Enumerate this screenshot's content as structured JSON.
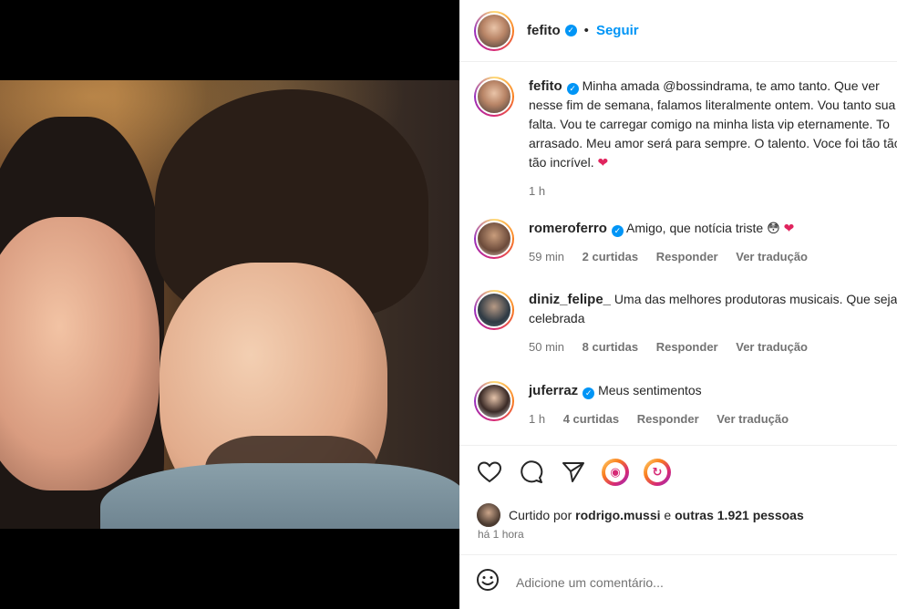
{
  "post": {
    "author": "fefito",
    "follow_label": "Seguir",
    "dot": "•"
  },
  "caption": {
    "author": "fefito",
    "text": "Minha amada @bossindrama, te amo tanto. Que ver nesse fim de semana, falamos literalmente ontem. Vou tanto sua falta. Vou te carregar comigo na minha lista vip eternamente. To arrasado. Meu amor será para sempre. O talento. Voce foi tão tão tão incrível.",
    "time": "1 h"
  },
  "comments": [
    {
      "user": "romeroferro",
      "text": "Amigo, que notícia triste",
      "emoji": "😳",
      "time": "59 min",
      "likes": "2 curtidas",
      "reply": "Responder",
      "translate": "Ver tradução",
      "verified": true
    },
    {
      "user": "diniz_felipe_",
      "text": "Uma das melhores produtoras musicais. Que seja celebrada",
      "time": "50 min",
      "likes": "8 curtidas",
      "reply": "Responder",
      "translate": "Ver tradução",
      "verified": false
    },
    {
      "user": "juferraz",
      "text": "Meus sentimentos",
      "time": "1 h",
      "likes": "4 curtidas",
      "reply": "Responder",
      "translate": "Ver tradução",
      "verified": true
    }
  ],
  "likes": {
    "prefix": "Curtido por",
    "user": "rodrigo.mussi",
    "conj": "e",
    "others": "outras 1.921 pessoas"
  },
  "posted": "há 1 hora",
  "add_comment": {
    "placeholder": "Adicione um comentário..."
  },
  "icons": [
    "heart-icon",
    "comment-icon",
    "share-icon",
    "reel-badge-icon",
    "repost-badge-icon",
    "emoji-icon"
  ],
  "colors": {
    "link": "#0095f6",
    "verified": "#0095f6",
    "muted": "#737373",
    "heart": "#e0245e"
  }
}
